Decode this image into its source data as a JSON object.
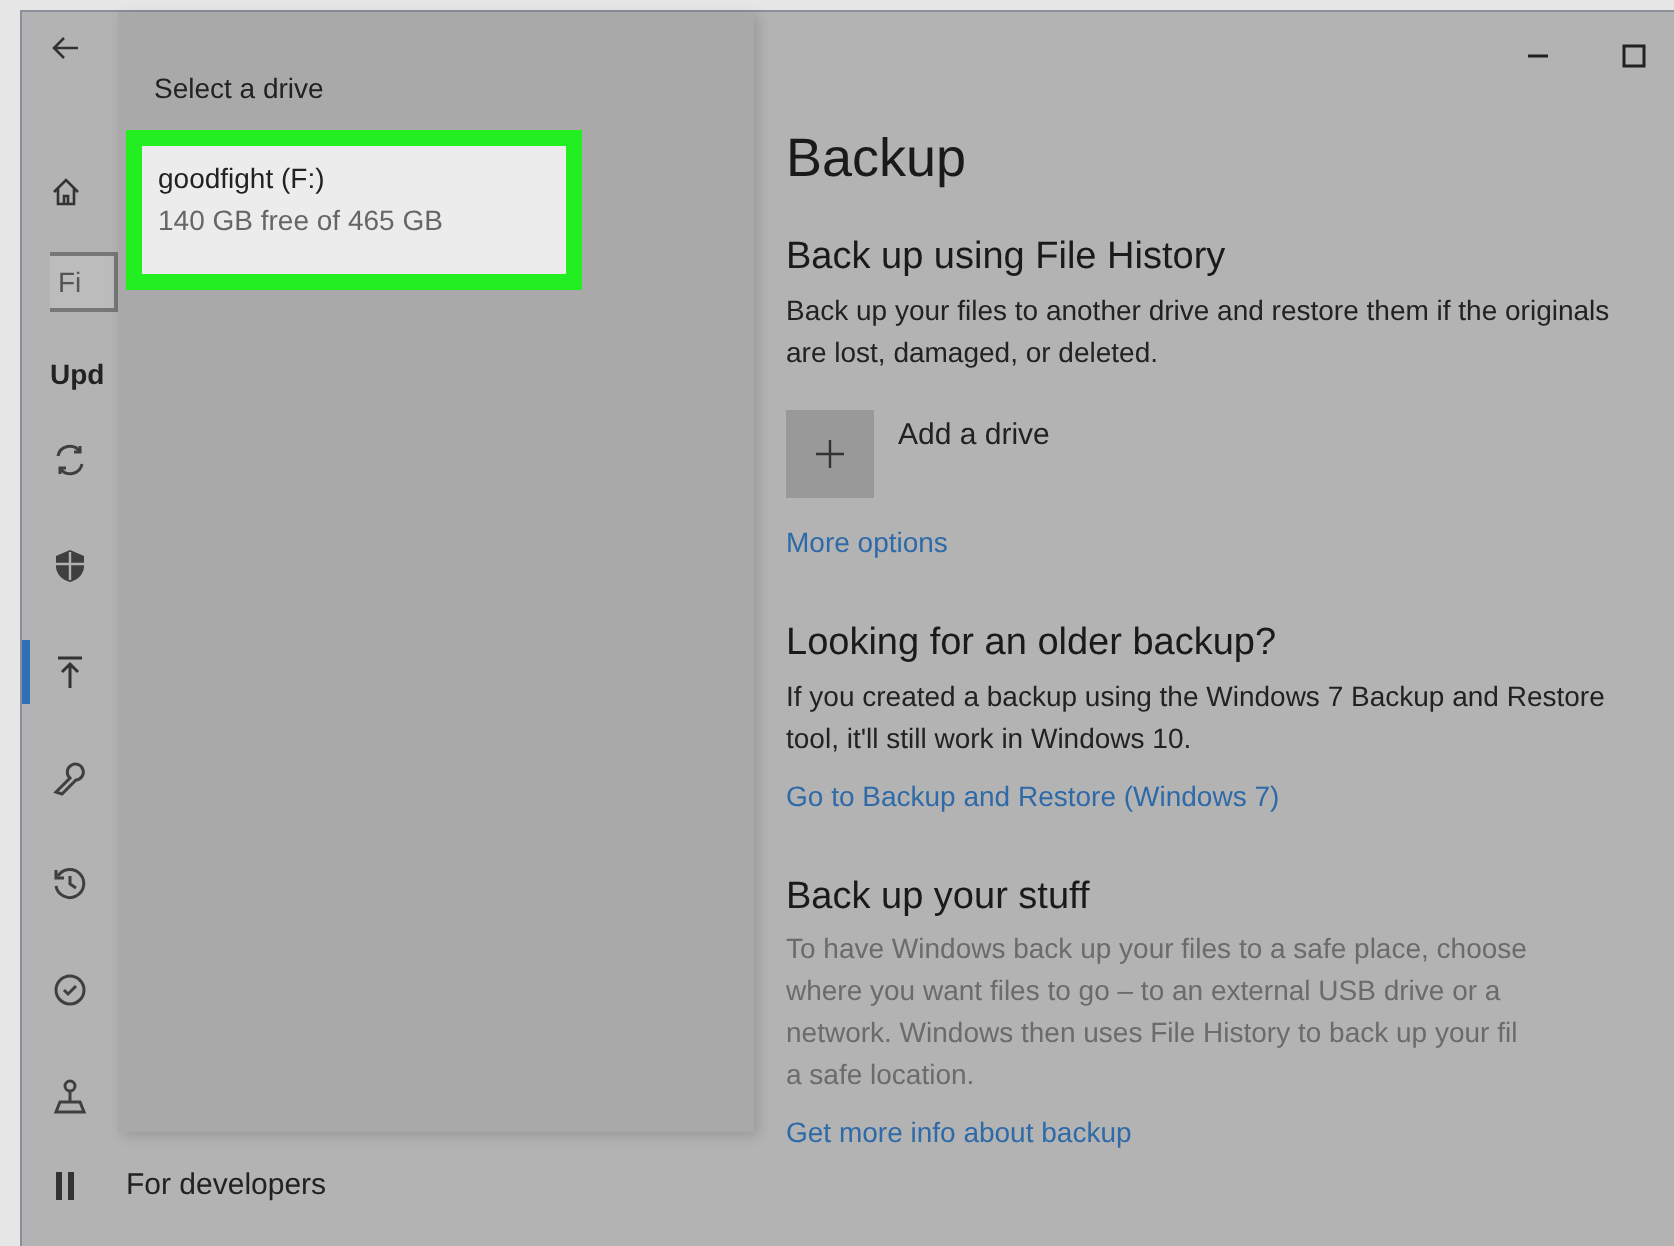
{
  "nav": {
    "search": {
      "placeholder": "Fi"
    },
    "heading": "Upd",
    "items": [
      {
        "kind": "sync",
        "selected": false
      },
      {
        "kind": "shield",
        "selected": false
      },
      {
        "kind": "backup",
        "selected": true
      },
      {
        "kind": "wrench",
        "selected": false
      },
      {
        "kind": "history",
        "selected": false
      },
      {
        "kind": "check",
        "selected": false
      },
      {
        "kind": "person",
        "selected": false
      }
    ],
    "bottom_item": {
      "label": "For developers"
    }
  },
  "flyout": {
    "title": "Select a drive",
    "drives": [
      {
        "name": "goodfight (F:)",
        "detail": "140 GB free of 465 GB",
        "highlighted": true
      }
    ]
  },
  "main": {
    "title": "Backup",
    "sections": [
      {
        "heading": "Back up using File History",
        "text": "Back up your files to another drive and restore them if the originals are lost, damaged, or deleted.",
        "muted": false,
        "add_button": {
          "label": "Add a drive"
        },
        "link": "More options"
      },
      {
        "heading": "Looking for an older backup?",
        "text": "If you created a backup using the Windows 7 Backup and Restore tool, it'll still work in Windows 10.",
        "muted": false,
        "link": "Go to Backup and Restore (Windows 7)"
      },
      {
        "heading": "Back up your stuff",
        "lines": [
          "To have Windows back up your files to a safe place, choose",
          "where you want files to go – to an external USB drive or a",
          "network. Windows then uses File History to back up your fil",
          "a safe location."
        ],
        "muted": true,
        "link": "Get more info about backup"
      }
    ]
  }
}
